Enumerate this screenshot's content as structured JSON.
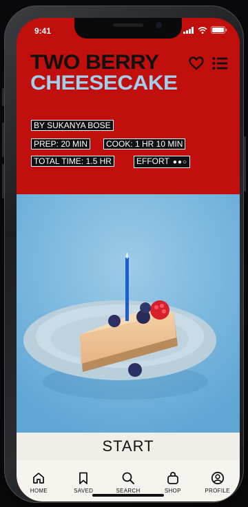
{
  "status": {
    "time": "9:41"
  },
  "recipe": {
    "title_line1": "TWO BERRY",
    "title_line2": "CHEESECAKE",
    "author": "BY SUKANYA BOSE",
    "prep": "PREP: 20 MIN",
    "cook": "COOK: 1 HR 10 MIN",
    "total": "TOTAL TIME: 1.5 HR",
    "effort_label": "EFFORT",
    "effort_level": 2,
    "effort_max": 3
  },
  "actions": {
    "start_label": "START"
  },
  "nav": {
    "items": [
      {
        "label": "HOME",
        "icon": "home-icon"
      },
      {
        "label": "SAVED",
        "icon": "bookmark-icon"
      },
      {
        "label": "SEARCH",
        "icon": "search-icon"
      },
      {
        "label": "SHOP",
        "icon": "shopping-bag-icon"
      },
      {
        "label": "PROFILE",
        "icon": "profile-icon"
      }
    ]
  },
  "colors": {
    "header_bg": "#c00f0c",
    "title_dark": "#111111",
    "title_accent": "#9fd0ee",
    "photo_bg": "#7db6dd",
    "footer_bg": "#f1eee7"
  }
}
